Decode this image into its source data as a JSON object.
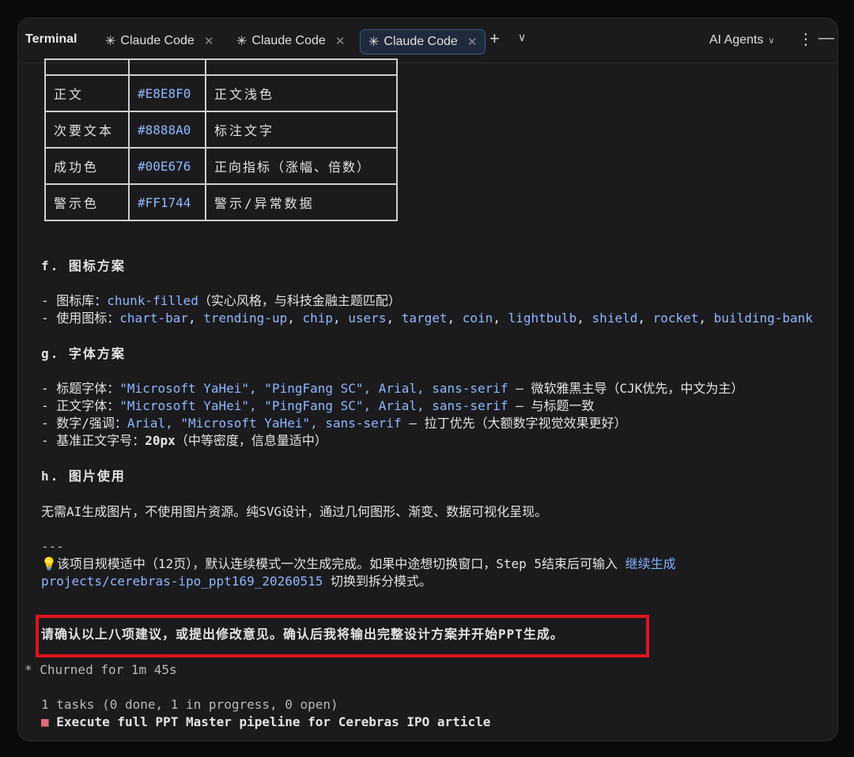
{
  "tabbar": {
    "app_title": "Terminal",
    "tabs": [
      {
        "label": "Claude Code",
        "active": false
      },
      {
        "label": "Claude Code",
        "active": false
      },
      {
        "label": "Claude Code",
        "active": true
      }
    ],
    "new_tab": "+",
    "tab_menu": "⌄",
    "agents_label": "AI Agents",
    "menu_icon": "more-vertical-icon",
    "minimize_icon": "minimize-icon"
  },
  "color_table": {
    "rows": [
      {
        "name": "正文",
        "hex": "#E8E8F0",
        "use": "正文浅色"
      },
      {
        "name": "次要文本",
        "hex": "#8888A0",
        "use": "标注文字"
      },
      {
        "name": "成功色",
        "hex": "#00E676",
        "use": "正向指标（涨幅、倍数）"
      },
      {
        "name": "警示色",
        "hex": "#FF1744",
        "use": "警示/异常数据"
      }
    ]
  },
  "section_f": {
    "heading": "f. 图标方案",
    "lib_prefix": "- 图标库：",
    "lib_value": "chunk-filled",
    "lib_suffix": "（实心风格，与科技金融主题匹配）",
    "icons_prefix": "- 使用图标：",
    "icons": [
      "chart-bar",
      "trending-up",
      "chip",
      "users",
      "target",
      "coin",
      "lightbulb",
      "shield",
      "rocket",
      "building-bank"
    ]
  },
  "section_g": {
    "heading": "g. 字体方案",
    "lines": [
      {
        "prefix": "- 标题字体：",
        "value": "\"Microsoft YaHei\", \"PingFang SC\", Arial, sans-serif",
        "suffix": " — 微软雅黑主导（CJK优先，中文为主）"
      },
      {
        "prefix": "- 正文字体：",
        "value": "\"Microsoft YaHei\", \"PingFang SC\", Arial, sans-serif",
        "suffix": " — 与标题一致"
      },
      {
        "prefix": "- 数字/强调：",
        "value": "Arial, \"Microsoft YaHei\", sans-serif",
        "suffix": " — 拉丁优先（大额数字视觉效果更好）"
      }
    ],
    "base_prefix": "- 基准正文字号：",
    "base_value": "20px",
    "base_suffix": "（中等密度，信息量适中）"
  },
  "section_h": {
    "heading": "h. 图片使用",
    "body": "无需AI生成图片，不使用图片资源。纯SVG设计，通过几何图形、渐变、数据可视化呈现。"
  },
  "separator": "---",
  "tip": {
    "icon": "💡",
    "text": "该项目规模适中（12页），默认连续模式一次生成完成。如果中途想切换窗口，Step 5结束后可输入",
    "command": "继续生成",
    "path": "projects/cerebras-ipo_ppt169_20260515",
    "suffix": " 切换到拆分模式。"
  },
  "confirm": "请确认以上八项建议，或提出修改意见。确认后我将输出完整设计方案并开始PPT生成。",
  "status": {
    "churned": "* Churned for 1m 45s",
    "tasks_summary": "1 tasks (0 done, 1 in progress, 0 open)",
    "task_marker": "■",
    "task": "Execute full PPT Master pipeline for Cerebras IPO article"
  }
}
